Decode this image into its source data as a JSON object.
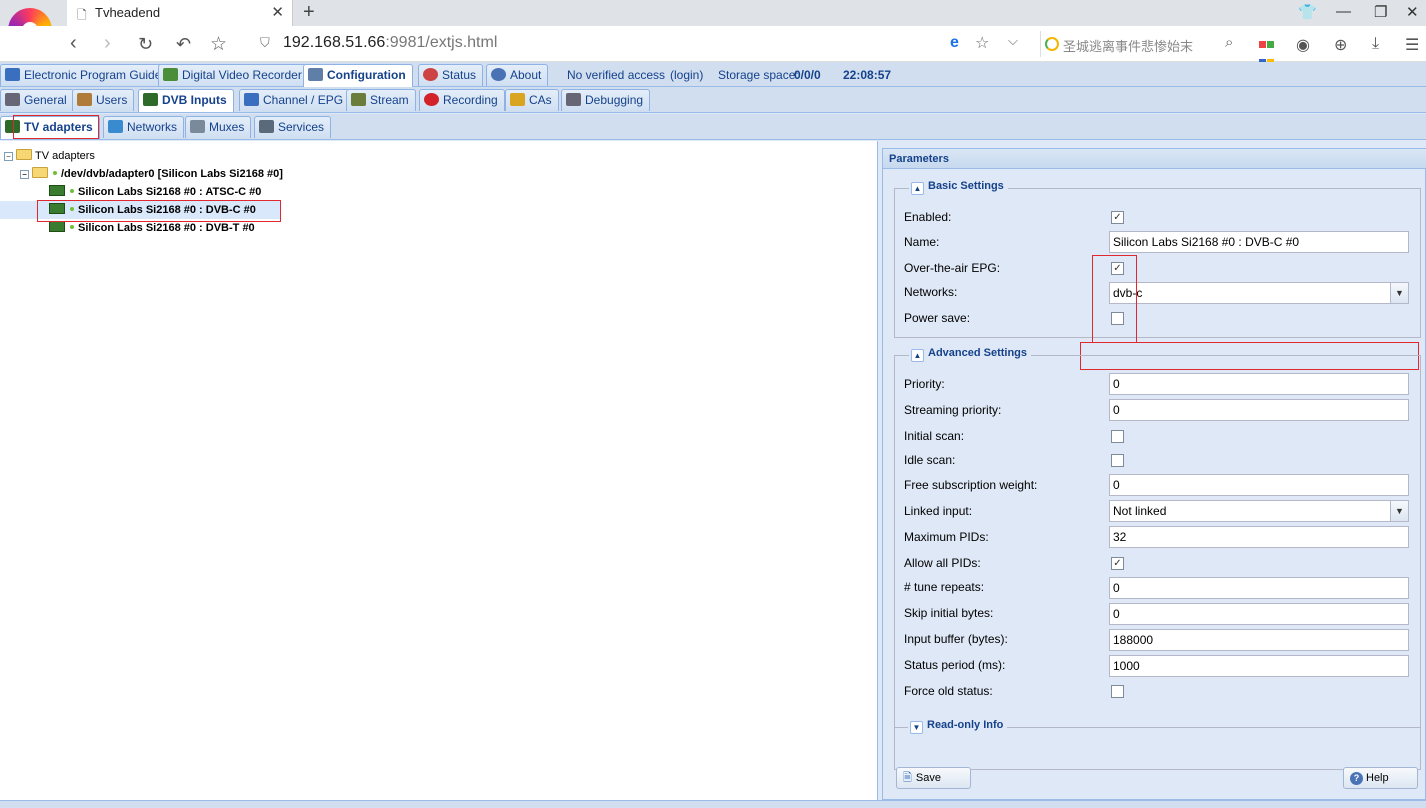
{
  "browser": {
    "tab_title": "Tvheadend",
    "url_host": "192.168.51.66",
    "url_rest": ":9981/extjs.html",
    "search_text": "圣城逃离事件悲惨始末"
  },
  "main_tabs": [
    {
      "label": "Electronic Program Guide",
      "icon": "epg-icon",
      "color": "#3a6ebf"
    },
    {
      "label": "Digital Video Recorder",
      "icon": "dvr-download-icon",
      "color": "#4a8e3a"
    },
    {
      "label": "Configuration",
      "icon": "wrench-icon",
      "color": "#5f7fa8"
    },
    {
      "label": "Status",
      "icon": "eye-icon",
      "color": "#c44"
    },
    {
      "label": "About",
      "icon": "info-icon",
      "color": "#4a73b5"
    }
  ],
  "status": {
    "access": "No verified access",
    "login": "(login)",
    "storage_label": "Storage space:",
    "storage_value": "0/0/0",
    "clock": "22:08:57"
  },
  "config_tabs": [
    {
      "label": "General",
      "icon": "tools-icon",
      "color": "#667"
    },
    {
      "label": "Users",
      "icon": "users-icon",
      "color": "#b07a3a"
    },
    {
      "label": "DVB Inputs",
      "icon": "tv-card-icon",
      "color": "#2e6b2a"
    },
    {
      "label": "Channel / EPG",
      "icon": "tv-icon",
      "color": "#3a6ebf"
    },
    {
      "label": "Stream",
      "icon": "stream-icon",
      "color": "#6a7d3a"
    },
    {
      "label": "Recording",
      "icon": "rec-icon",
      "color": "#d2222a"
    },
    {
      "label": "CAs",
      "icon": "key-icon",
      "color": "#d9a520"
    },
    {
      "label": "Debugging",
      "icon": "bug-icon",
      "color": "#667"
    }
  ],
  "dvb_tabs": [
    {
      "label": "TV adapters",
      "icon": "tv-card-icon",
      "color": "#2e6b2a"
    },
    {
      "label": "Networks",
      "icon": "antenna-icon",
      "color": "#3a8ad0"
    },
    {
      "label": "Muxes",
      "icon": "mux-icon",
      "color": "#7a8a9a"
    },
    {
      "label": "Services",
      "icon": "services-icon",
      "color": "#5a6a7a"
    }
  ],
  "tree": {
    "root": "TV adapters",
    "adapter": "/dev/dvb/adapter0 [Silicon Labs Si2168 #0]",
    "frontends": [
      "Silicon Labs Si2168 #0 : ATSC-C #0",
      "Silicon Labs Si2168 #0 : DVB-C #0",
      "Silicon Labs Si2168 #0 : DVB-T #0"
    ]
  },
  "params": {
    "title": "Parameters",
    "basic": {
      "legend": "Basic Settings",
      "enabled_label": "Enabled:",
      "enabled": true,
      "name_label": "Name:",
      "name_value": "Silicon Labs Si2168 #0 : DVB-C #0",
      "epg_label": "Over-the-air EPG:",
      "epg": true,
      "networks_label": "Networks:",
      "networks_value": "dvb-c",
      "powersave_label": "Power save:",
      "powersave": false
    },
    "advanced": {
      "legend": "Advanced Settings",
      "priority_label": "Priority:",
      "priority": "0",
      "spriority_label": "Streaming priority:",
      "spriority": "0",
      "initscan_label": "Initial scan:",
      "idlescan_label": "Idle scan:",
      "freesub_label": "Free subscription weight:",
      "freesub": "0",
      "linked_label": "Linked input:",
      "linked": "Not linked",
      "maxpids_label": "Maximum PIDs:",
      "maxpids": "32",
      "allpids_label": "Allow all PIDs:",
      "tune_label": "# tune repeats:",
      "tune": "0",
      "skip_label": "Skip initial bytes:",
      "skip": "0",
      "buffer_label": "Input buffer (bytes):",
      "buffer": "188000",
      "period_label": "Status period (ms):",
      "period": "1000",
      "oldstatus_label": "Force old status:"
    },
    "readonly_legend": "Read-only Info",
    "save_label": "Save",
    "help_label": "Help"
  }
}
